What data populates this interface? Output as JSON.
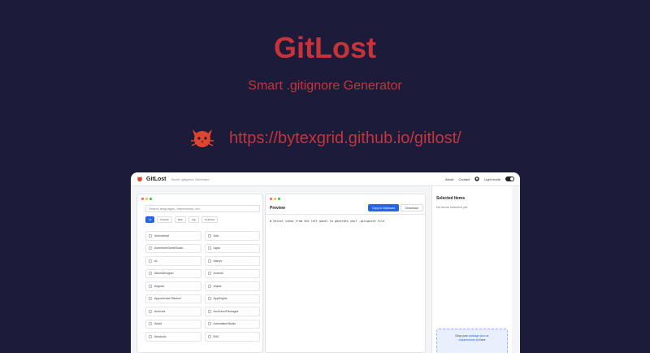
{
  "hero": {
    "title": "GitLost",
    "subtitle": "Smart .gitignore Generator",
    "url": "https://bytexgrid.github.io/gitlost/",
    "logo_icon": "cat-logo-icon",
    "accent_color": "#c6343a"
  },
  "app": {
    "name": "GitLost",
    "tagline": "Smart .gitignore Generator",
    "nav": {
      "about": "About",
      "contact": "Contact",
      "theme_label": "Light mode"
    }
  },
  "left_panel": {
    "search_placeholder": "Search languages, frameworks, etc.",
    "filters": [
      "All",
      "Popular",
      "Web",
      "App",
      "Selected"
    ],
    "templates": [
      "Actionscript",
      "Ada",
      "AdventureGameStudio",
      "Agda",
      "AL",
      "Alteryx",
      "AltiumDesigner",
      "Android",
      "Angular",
      "Anjuta",
      "AppceleratorTitanium",
      "AppEngine",
      "Archives",
      "ArchLinuxPackages",
      "Autoit",
      "AutomationStudio",
      "Autotools",
      "B4X"
    ]
  },
  "preview": {
    "title": "Preview",
    "copy_label": "Copy to Clipboard",
    "download_label": "Download",
    "code": "# Select items from the left panel to generate your .gitignore file"
  },
  "selected": {
    "title": "Selected Items",
    "empty_text": "No items selected yet.",
    "drop_line1_a": "Drop your ",
    "drop_line1_b": "package.json",
    "drop_line1_c": " or",
    "drop_line2_a": "requirements.txt",
    "drop_line2_b": " here"
  }
}
